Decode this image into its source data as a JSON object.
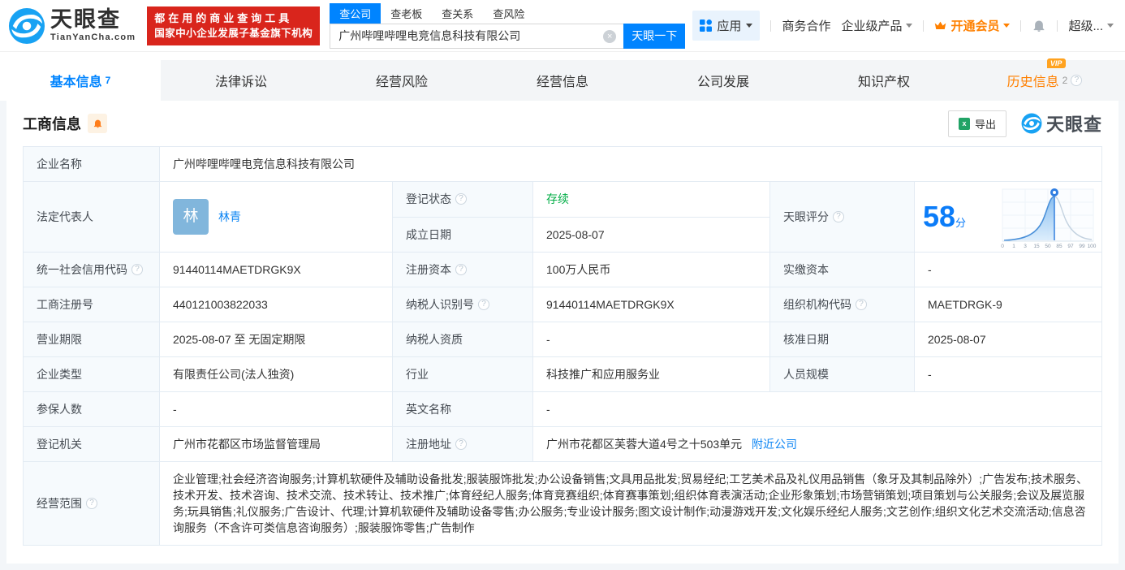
{
  "brand": {
    "name": "天眼查",
    "domain": "TianYanCha.com",
    "slogan1": "都在用的商业查询工具",
    "slogan2": "国家中小企业发展子基金旗下机构"
  },
  "search": {
    "tabs": [
      "查公司",
      "查老板",
      "查关系",
      "查风险"
    ],
    "value": "广州哔哩哔哩电竞信息科技有限公司",
    "button": "天眼一下",
    "clear": "×"
  },
  "nav": {
    "apps": "应用",
    "biz": "商务合作",
    "enterprise": "企业级产品",
    "vip": "开通会员",
    "more": "超级..."
  },
  "tabs": {
    "t1": "基本信息",
    "t1n": "7",
    "t2": "法律诉讼",
    "t3": "经营风险",
    "t4": "经营信息",
    "t5": "公司发展",
    "t6": "知识产权",
    "t7": "历史信息",
    "t7n": "2",
    "vip_badge": "VIP",
    "help": "?"
  },
  "section": {
    "title": "工商信息",
    "export": "导出",
    "logo": "天眼查"
  },
  "info": {
    "name_label": "企业名称",
    "name": "广州哔哩哔哩电竞信息科技有限公司",
    "legal_rep_label": "法定代表人",
    "avatar": "林",
    "legal_rep": "林青",
    "reg_status_label": "登记状态",
    "reg_status": "存续",
    "establish_label": "成立日期",
    "establish": "2025-08-07",
    "uscc_label": "统一社会信用代码",
    "uscc": "91440114MAETDRGK9X",
    "reg_capital_label": "注册资本",
    "reg_capital": "100万人民币",
    "paid_capital_label": "实缴资本",
    "paid_capital": "-",
    "reg_no_label": "工商注册号",
    "reg_no": "440121003822033",
    "taxpayer_id_label": "纳税人识别号",
    "taxpayer_id": "91440114MAETDRGK9X",
    "org_code_label": "组织机构代码",
    "org_code": "MAETDRGK-9",
    "term_label": "营业期限",
    "term": "2025-08-07 至 无固定期限",
    "taxpayer_quali_label": "纳税人资质",
    "taxpayer_quali": "-",
    "approval_label": "核准日期",
    "approval": "2025-08-07",
    "type_label": "企业类型",
    "type": "有限责任公司(法人独资)",
    "industry_label": "行业",
    "industry": "科技推广和应用服务业",
    "staff_label": "人员规模",
    "staff": "-",
    "insured_label": "参保人数",
    "insured": "-",
    "en_name_label": "英文名称",
    "en_name": "-",
    "authority_label": "登记机关",
    "authority": "广州市花都区市场监督管理局",
    "address_label": "注册地址",
    "address": "广州市花都区芙蓉大道4号之十503单元",
    "nearby": "附近公司",
    "scope_label": "经营范围",
    "scope": "企业管理;社会经济咨询服务;计算机软硬件及辅助设备批发;服装服饰批发;办公设备销售;文具用品批发;贸易经纪;工艺美术品及礼仪用品销售（象牙及其制品除外）;广告发布;技术服务、技术开发、技术咨询、技术交流、技术转让、技术推广;体育经纪人服务;体育竞赛组织;体育赛事策划;组织体育表演活动;企业形象策划;市场营销策划;项目策划与公关服务;会议及展览服务;玩具销售;礼仪服务;广告设计、代理;计算机软硬件及辅助设备零售;办公服务;专业设计服务;图文设计制作;动漫游戏开发;文化娱乐经纪人服务;文艺创作;组织文化艺术交流活动;信息咨询服务（不含许可类信息咨询服务）;服装服饰零售;广告制作"
  },
  "score": {
    "label": "天眼评分",
    "num": "58",
    "unit": "分",
    "ticks": [
      "0",
      "1",
      "3",
      "15",
      "50",
      "85",
      "97",
      "99",
      "100"
    ]
  }
}
